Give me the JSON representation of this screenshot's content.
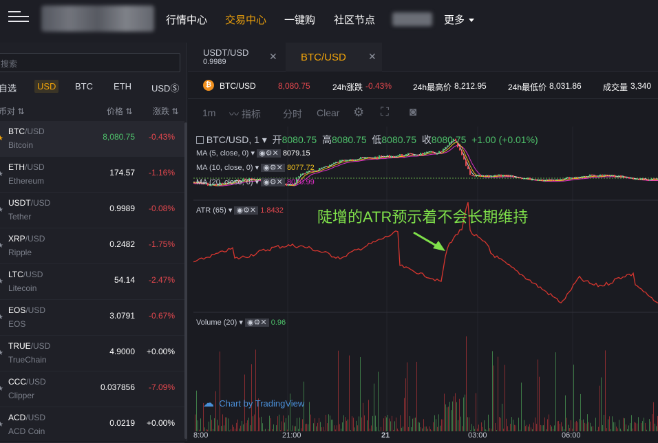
{
  "topnav": {
    "items": [
      "行情中心",
      "交易中心",
      "一键购",
      "社区节点"
    ],
    "active_index": 1,
    "more_label": "更多"
  },
  "sidebar": {
    "search_placeholder": "搜索",
    "quote_tabs": [
      "自选",
      "USD",
      "BTC",
      "ETH",
      "USDⓈ"
    ],
    "active_tab": "USD",
    "col_pair": "币对",
    "col_price": "价格",
    "col_change": "涨跌",
    "rows": [
      {
        "base": "BTC",
        "quote": "/USD",
        "name": "Bitcoin",
        "price": "8,080.75",
        "change": "-0.43%"
      },
      {
        "base": "ETH",
        "quote": "/USD",
        "name": "Ethereum",
        "price": "174.57",
        "change": "-1.16%"
      },
      {
        "base": "USDT",
        "quote": "/USD",
        "name": "Tether",
        "price": "0.9989",
        "change": "-0.08%"
      },
      {
        "base": "XRP",
        "quote": "/USD",
        "name": "Ripple",
        "price": "0.2482",
        "change": "-1.75%"
      },
      {
        "base": "LTC",
        "quote": "/USD",
        "name": "Litecoin",
        "price": "54.14",
        "change": "-2.47%"
      },
      {
        "base": "EOS",
        "quote": "/USD",
        "name": "EOS",
        "price": "3.0791",
        "change": "-0.67%"
      },
      {
        "base": "TRUE",
        "quote": "/USD",
        "name": "TrueChain",
        "price": "4.9000",
        "change": "+0.00%"
      },
      {
        "base": "CCC",
        "quote": "/USD",
        "name": "Clipper",
        "price": "0.037856",
        "change": "-7.09%"
      },
      {
        "base": "ACD",
        "quote": "/USD",
        "name": "ACD Coin",
        "price": "0.0219",
        "change": "+0.00%"
      }
    ]
  },
  "chart_tabs": [
    {
      "title": "USDT/USD",
      "sub": "0.9989"
    },
    {
      "title": "BTC/USD",
      "sub": ""
    }
  ],
  "ticker": {
    "pair": "BTC/USD",
    "last": "8,080.75",
    "change_label": "24h涨跌",
    "change": "-0.43%",
    "high_label": "24h最高价",
    "high": "8,212.95",
    "low_label": "24h最低价",
    "low": "8,031.86",
    "vol_label": "成交量",
    "vol": "3,340"
  },
  "toolbar": {
    "interval": "1m",
    "indicators": "指标",
    "timeshare": "分时",
    "clear": "Clear"
  },
  "legend": {
    "symbol": "BTC/USD, 1",
    "open_label": "开",
    "open": "8080.75",
    "high_label": "高",
    "high": "8080.75",
    "low_label": "低",
    "low": "8080.75",
    "close_label": "收",
    "close": "8080.75",
    "change": "+1.00 (+0.01%)",
    "ma5_label": "MA (5, close, 0)",
    "ma5": "8079.15",
    "ma10_label": "MA (10, close, 0)",
    "ma10": "8077.72",
    "ma20_label": "MA (20, close, 0)",
    "ma20": "8070.99",
    "atr_label": "ATR (65)",
    "atr": "1.8432",
    "vol_label": "Volume (20)",
    "vol": "0.96"
  },
  "annotation": "陡增的ATR预示着不会长期维持",
  "watermark": "Chart by TradingView",
  "xaxis": [
    "8:00",
    "21:00",
    "21",
    "03:00",
    "06:00"
  ],
  "colors": {
    "accent": "#f0a30a",
    "up": "#4ec26b",
    "down": "#e6484e",
    "atr": "#d8362f",
    "annotation": "#7fe04a"
  }
}
